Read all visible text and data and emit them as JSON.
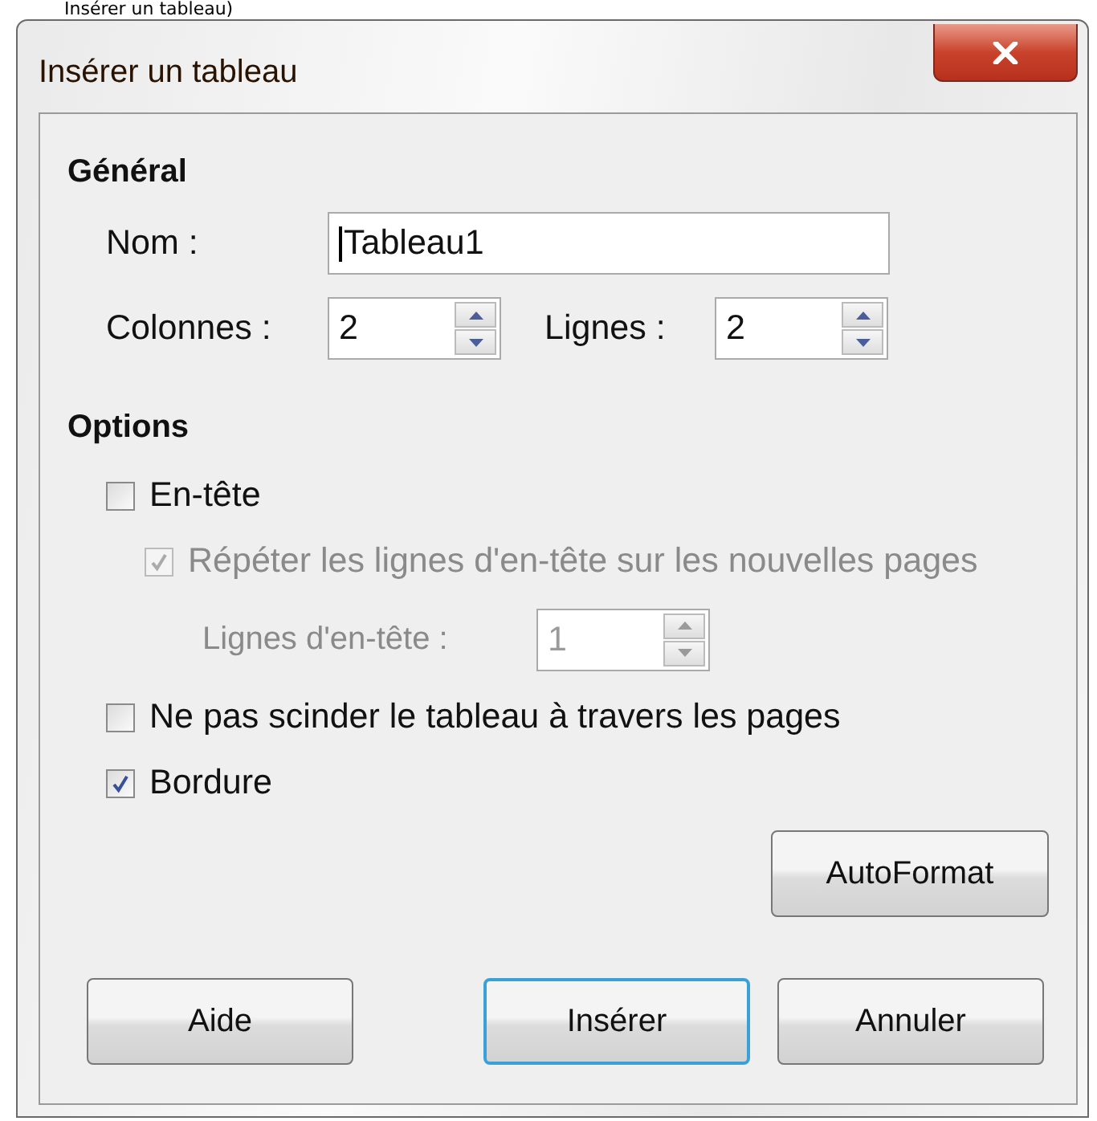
{
  "background_text": "Insérer un tableau)",
  "window": {
    "title": "Insérer un tableau"
  },
  "general": {
    "heading": "Général",
    "name": {
      "label": "Nom :",
      "value": "Tableau1"
    },
    "columns": {
      "label": "Colonnes :",
      "value": "2"
    },
    "rows": {
      "label": "Lignes :",
      "value": "2"
    }
  },
  "options": {
    "heading": "Options",
    "items": [
      {
        "kind": "checkbox",
        "label": "En-tête",
        "checked": false,
        "disabled": false,
        "children": [
          {
            "kind": "checkbox",
            "label": "Répéter les lignes d'en-tête sur les nouvelles pages",
            "checked": true,
            "disabled": true,
            "children": [
              {
                "kind": "spin",
                "label": "Lignes d'en-tête :",
                "value": "1",
                "disabled": true
              }
            ]
          }
        ]
      },
      {
        "kind": "checkbox",
        "label": "Ne pas scinder le tableau à travers les pages",
        "checked": false,
        "disabled": false
      },
      {
        "kind": "checkbox",
        "label": "Bordure",
        "checked": true,
        "disabled": false
      }
    ]
  },
  "autoformat": {
    "label": "AutoFormat"
  },
  "buttons": [
    {
      "label": "Aide",
      "default": false
    },
    {
      "label": "Insérer",
      "default": true
    },
    {
      "label": "Annuler",
      "default": false
    }
  ]
}
